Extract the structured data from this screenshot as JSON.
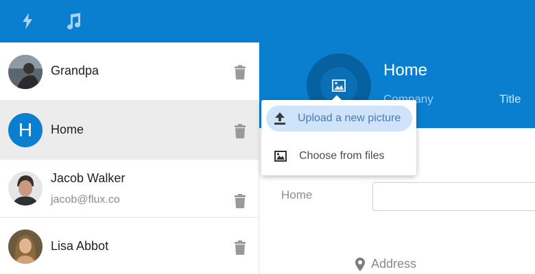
{
  "topbar": {
    "icons": [
      "lightning-icon",
      "music-note-icon"
    ]
  },
  "contacts": [
    {
      "name": "Grandpa",
      "email": "",
      "avatar": "photo"
    },
    {
      "name": "Home",
      "email": "",
      "avatar": "letter",
      "letter": "H",
      "selected": true
    },
    {
      "name": "Jacob Walker",
      "email": "jacob@flux.co",
      "avatar": "photo"
    },
    {
      "name": "Lisa Abbot",
      "email": "",
      "avatar": "photo"
    }
  ],
  "detail": {
    "title": "Home",
    "company_placeholder": "Company",
    "title_placeholder": "Title"
  },
  "form": {
    "phone_label": "Home",
    "phone_value": "",
    "address_label": "Address"
  },
  "menu": {
    "items": [
      {
        "label": "Upload a new picture",
        "icon": "upload-icon",
        "active": true
      },
      {
        "label": "Choose from files",
        "icon": "image-icon",
        "active": false
      }
    ]
  },
  "colors": {
    "brand": "#0a7fd0",
    "header_dark": "#07609f",
    "menu_active": "#cfe3fb",
    "selected_row": "#ececec"
  }
}
